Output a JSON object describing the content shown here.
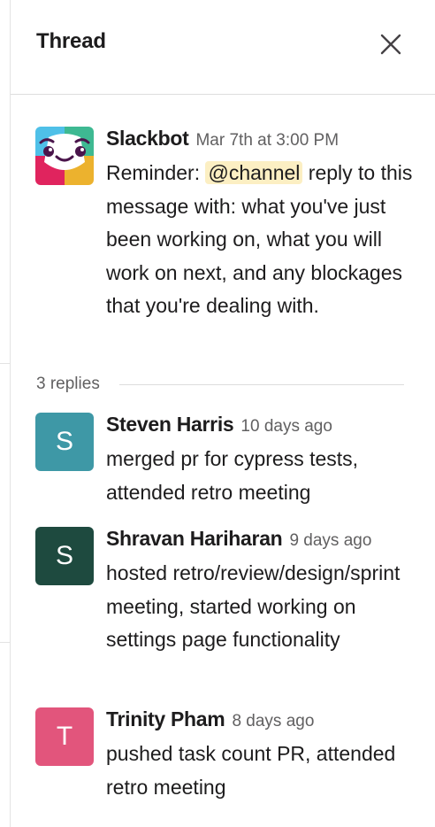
{
  "header": {
    "title": "Thread",
    "close_icon": "close-icon"
  },
  "parent": {
    "author": "Slackbot",
    "timestamp": "Mar 7th at 3:00 PM",
    "text_before": "Reminder: ",
    "mention": "@channel",
    "text_after": " reply to this message with: what you've just been working on, what you will work on next, and any blockages that you're dealing with.",
    "avatar_icon": "slackbot-avatar-icon"
  },
  "replies_count": "3 replies",
  "replies": [
    {
      "author": "Steven Harris",
      "timestamp": "10 days ago",
      "initial": "S",
      "avatar_color": "#3e98a6",
      "text": "merged pr for cypress tests, attended retro meeting"
    },
    {
      "author": "Shravan Hariharan",
      "timestamp": "9 days ago",
      "initial": "S",
      "avatar_color": "#1e4a3f",
      "text": "hosted retro/review/design/sprint meeting, started working on settings page functionality"
    },
    {
      "author": "Trinity Pham",
      "timestamp": "8 days ago",
      "initial": "T",
      "avatar_color": "#e2557c",
      "text": "pushed task count PR, attended retro meeting"
    }
  ]
}
